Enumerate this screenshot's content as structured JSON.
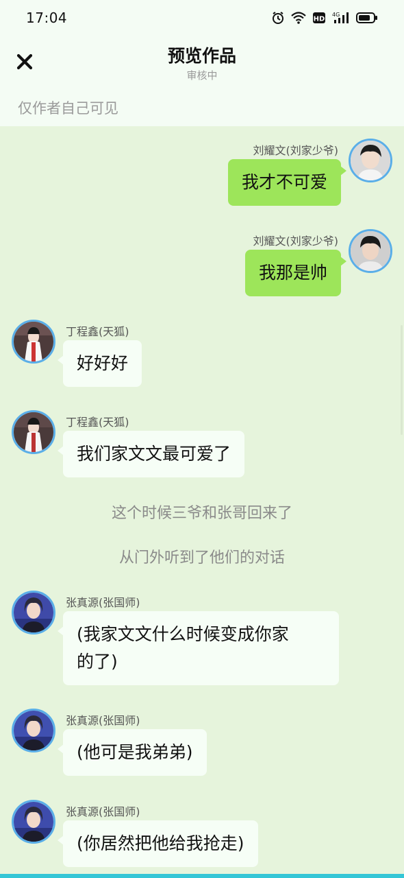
{
  "status_bar": {
    "time": "17:04",
    "icons": [
      "alarm-icon",
      "wifi-icon",
      "hd-icon",
      "signal-4g-icon",
      "battery-icon"
    ],
    "hd_label": "HD",
    "network_label": "4G"
  },
  "header": {
    "title": "预览作品",
    "subtitle": "审核中",
    "visibility": "仅作者自己可见",
    "close_icon": "close-icon"
  },
  "messages": [
    {
      "side": "right",
      "sender": "刘耀文(刘家少爷)",
      "text": "我才不可爱"
    },
    {
      "side": "right",
      "sender": "刘耀文(刘家少爷)",
      "text": "我那是帅"
    },
    {
      "side": "left",
      "sender": "丁程鑫(天狐)",
      "text": "好好好"
    },
    {
      "side": "left",
      "sender": "丁程鑫(天狐)",
      "text": "我们家文文最可爱了"
    },
    {
      "side": "left",
      "sender": "张真源(张国师)",
      "text_line1": "(我家文文什么时候变成你家",
      "text_line2": "的了)"
    },
    {
      "side": "left",
      "sender": "张真源(张国师)",
      "text": "(他可是我弟弟)"
    },
    {
      "side": "left",
      "sender": "张真源(张国师)",
      "text": "(你居然把他给我抢走)"
    }
  ],
  "narrations": [
    "这个时候三爷和张哥回来了",
    "从门外听到了他们的对话"
  ],
  "colors": {
    "background": "#e6f4dc",
    "header": "#f4fcf4",
    "my_bubble": "#9de55a",
    "other_bubble": "#f6fef6",
    "avatar_ring": "#5aaee8",
    "bottom_strip": "#34c6d6"
  }
}
